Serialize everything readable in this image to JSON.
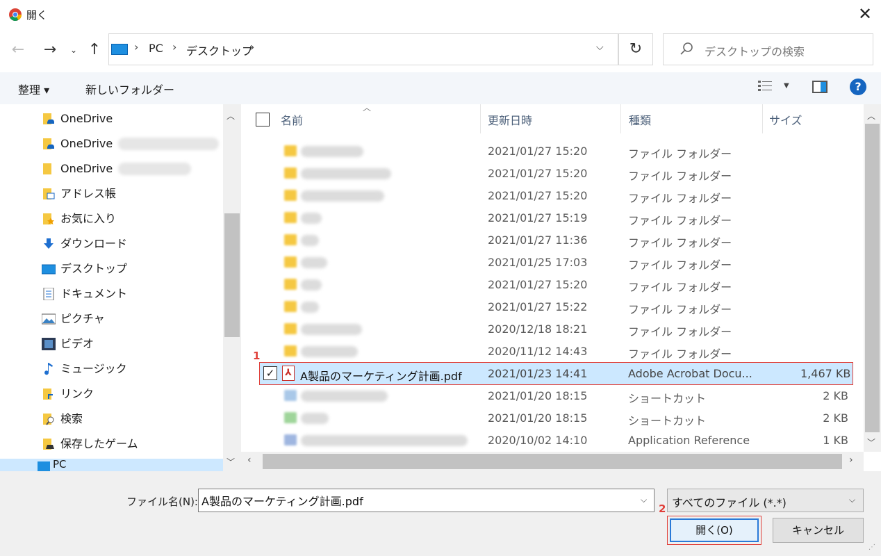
{
  "window": {
    "title": "開く",
    "close_glyph": "✕"
  },
  "address": {
    "crumbs": [
      "PC",
      "デスクトップ"
    ],
    "search_placeholder": "デスクトップの検索"
  },
  "toolbar": {
    "organize": "整理 ▾",
    "new_folder": "新しいフォルダー",
    "help": "?"
  },
  "nav": {
    "items": [
      {
        "label": "OneDrive",
        "icon": "onedrive-folder-icon"
      },
      {
        "label": "OneDrive",
        "icon": "onedrive-folder-icon"
      },
      {
        "label": "OneDrive",
        "icon": "folder-icon"
      },
      {
        "label": "アドレス帳",
        "icon": "contacts-folder-icon"
      },
      {
        "label": "お気に入り",
        "icon": "favorites-folder-icon"
      },
      {
        "label": "ダウンロード",
        "icon": "download-arrow-icon"
      },
      {
        "label": "デスクトップ",
        "icon": "desktop-icon"
      },
      {
        "label": "ドキュメント",
        "icon": "document-icon"
      },
      {
        "label": "ピクチャ",
        "icon": "picture-icon"
      },
      {
        "label": "ビデオ",
        "icon": "video-icon"
      },
      {
        "label": "ミュージック",
        "icon": "music-note-icon"
      },
      {
        "label": "リンク",
        "icon": "links-folder-icon"
      },
      {
        "label": "検索",
        "icon": "search-folder-icon"
      },
      {
        "label": "保存したゲーム",
        "icon": "saved-games-icon"
      },
      {
        "label": "PC",
        "icon": "pc-icon"
      }
    ]
  },
  "columns": {
    "name": "名前",
    "date": "更新日時",
    "type": "種類",
    "size": "サイズ"
  },
  "files": [
    {
      "date": "2021/01/27 15:20",
      "type": "ファイル フォルダー",
      "size": ""
    },
    {
      "date": "2021/01/27 15:20",
      "type": "ファイル フォルダー",
      "size": ""
    },
    {
      "date": "2021/01/27 15:20",
      "type": "ファイル フォルダー",
      "size": ""
    },
    {
      "date": "2021/01/27 15:19",
      "type": "ファイル フォルダー",
      "size": ""
    },
    {
      "date": "2021/01/27 11:36",
      "type": "ファイル フォルダー",
      "size": ""
    },
    {
      "date": "2021/01/25 17:03",
      "type": "ファイル フォルダー",
      "size": ""
    },
    {
      "date": "2021/01/27 15:20",
      "type": "ファイル フォルダー",
      "size": ""
    },
    {
      "date": "2021/01/27 15:22",
      "type": "ファイル フォルダー",
      "size": ""
    },
    {
      "date": "2020/12/18 18:21",
      "type": "ファイル フォルダー",
      "size": ""
    },
    {
      "date": "2020/11/12 14:43",
      "type": "ファイル フォルダー",
      "size": ""
    }
  ],
  "selected_file": {
    "name": "A製品のマーケティング計画.pdf",
    "date": "2021/01/23 14:41",
    "type": "Adobe Acrobat Docu...",
    "size": "1,467 KB"
  },
  "files_after": [
    {
      "date": "2021/01/20 18:15",
      "type": "ショートカット",
      "size": "2 KB"
    },
    {
      "date": "2021/01/20 18:15",
      "type": "ショートカット",
      "size": "2 KB"
    },
    {
      "date": "2020/10/02 14:10",
      "type": "Application Reference",
      "size": "1 KB"
    }
  ],
  "bottom": {
    "filename_label": "ファイル名(N):",
    "filename_value": "A製品のマーケティング計画.pdf",
    "filter": "すべてのファイル (*.*)",
    "open": "開く(O)",
    "cancel": "キャンセル"
  },
  "annotations": {
    "marker1": "1",
    "marker2": "2"
  },
  "colors": {
    "accent": "#e0403a",
    "selection": "#cce8ff",
    "folder": "#f5c842"
  }
}
